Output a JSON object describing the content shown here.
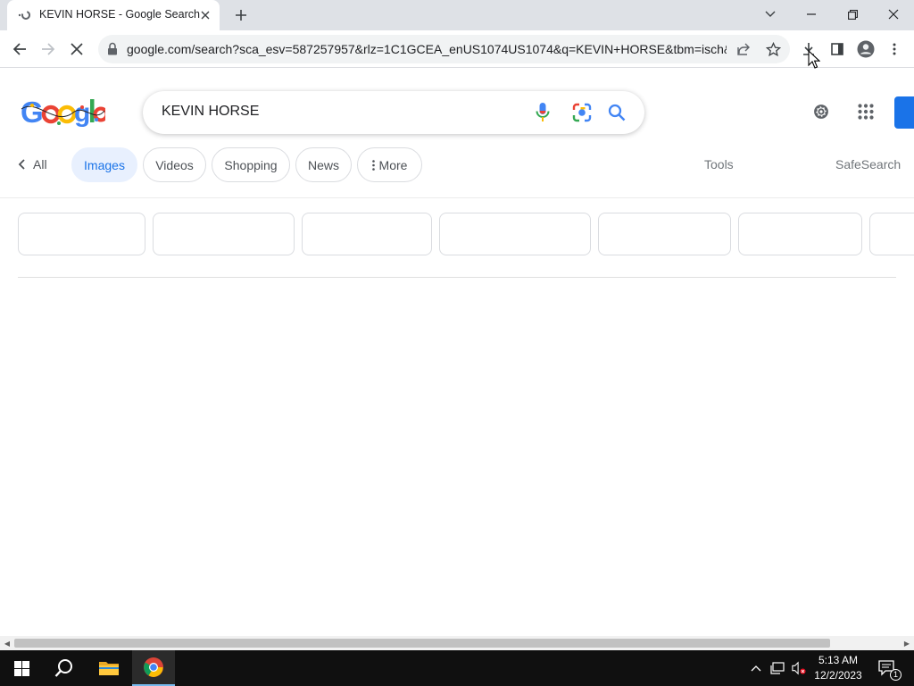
{
  "browser": {
    "tab_title": "KEVIN HORSE - Google Search",
    "url": "google.com/search?sca_esv=587257957&rlz=1C1GCEA_enUS1074US1074&q=KEVIN+HORSE&tbm=isch&..."
  },
  "search": {
    "query": "KEVIN HORSE"
  },
  "filters": {
    "all_label": "All",
    "chips": [
      {
        "label": "Images",
        "active": true
      },
      {
        "label": "Videos"
      },
      {
        "label": "Shopping"
      },
      {
        "label": "News"
      },
      {
        "label": "More"
      }
    ],
    "tools_label": "Tools",
    "safesearch_label": "SafeSearch"
  },
  "taskbar": {
    "time": "5:13 AM",
    "date": "12/2/2023",
    "notification_count": "1"
  },
  "colors": {
    "accent": "#1a73e8",
    "chip_active_bg": "#e8f0fe",
    "taskbar": "#101010"
  }
}
